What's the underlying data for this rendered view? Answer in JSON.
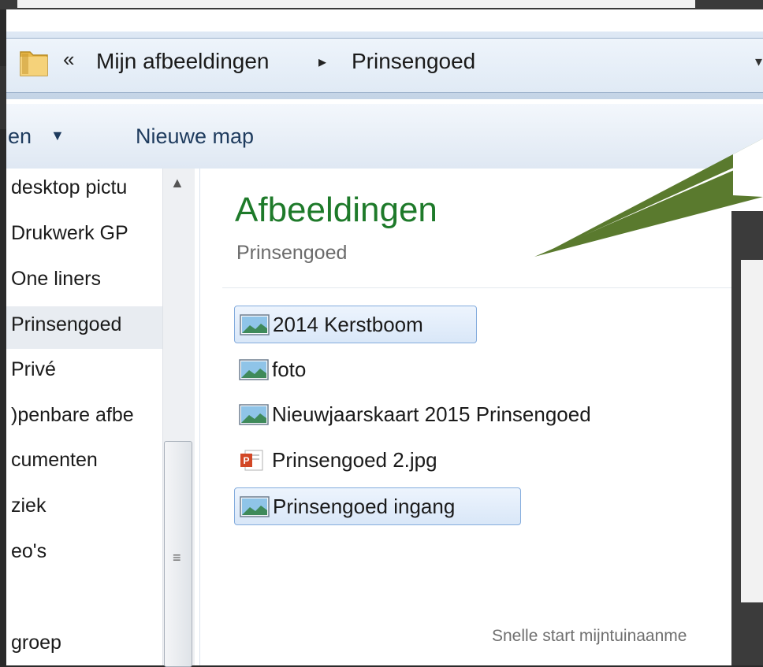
{
  "address": {
    "back_glyph": "«",
    "crumbs": [
      "Mijn afbeeldingen",
      "Prinsengoed"
    ],
    "separator": "▸",
    "dropdown_glyph": "▾"
  },
  "toolbar": {
    "organize_label": "en",
    "organize_arrow": "▼",
    "new_folder_label": "Nieuwe map"
  },
  "nav": {
    "items": [
      {
        "label": "desktop pictu",
        "selected": false
      },
      {
        "label": "Drukwerk GP",
        "selected": false
      },
      {
        "label": "One liners",
        "selected": false
      },
      {
        "label": "Prinsengoed",
        "selected": true
      },
      {
        "label": "Privé",
        "selected": false
      },
      {
        "label": ")penbare afbe",
        "selected": false
      },
      {
        "label": "cumenten",
        "selected": false
      },
      {
        "label": "ziek",
        "selected": false
      },
      {
        "label": "eo's",
        "selected": false
      },
      {
        "label": "",
        "selected": false
      },
      {
        "label": "groep",
        "selected": false
      }
    ],
    "scroll_up_glyph": "▲",
    "scroll_grip_glyph": "≡"
  },
  "library": {
    "title": "Afbeeldingen",
    "subtitle": "Prinsengoed"
  },
  "files": [
    {
      "name": "2014 Kerstboom",
      "type": "image",
      "selected": true
    },
    {
      "name": "foto",
      "type": "image",
      "selected": false
    },
    {
      "name": "Nieuwjaarskaart 2015 Prinsengoed",
      "type": "image",
      "selected": false
    },
    {
      "name": "Prinsengoed 2.jpg",
      "type": "powerpoint",
      "selected": false
    },
    {
      "name": "Prinsengoed ingang",
      "type": "image",
      "selected": true
    }
  ],
  "footer": {
    "text": "Snelle start mijntuinaanme"
  },
  "colors": {
    "library_title": "#1e7a2a",
    "arrow": "#5a7a2e",
    "selection_border": "#84acdd"
  }
}
